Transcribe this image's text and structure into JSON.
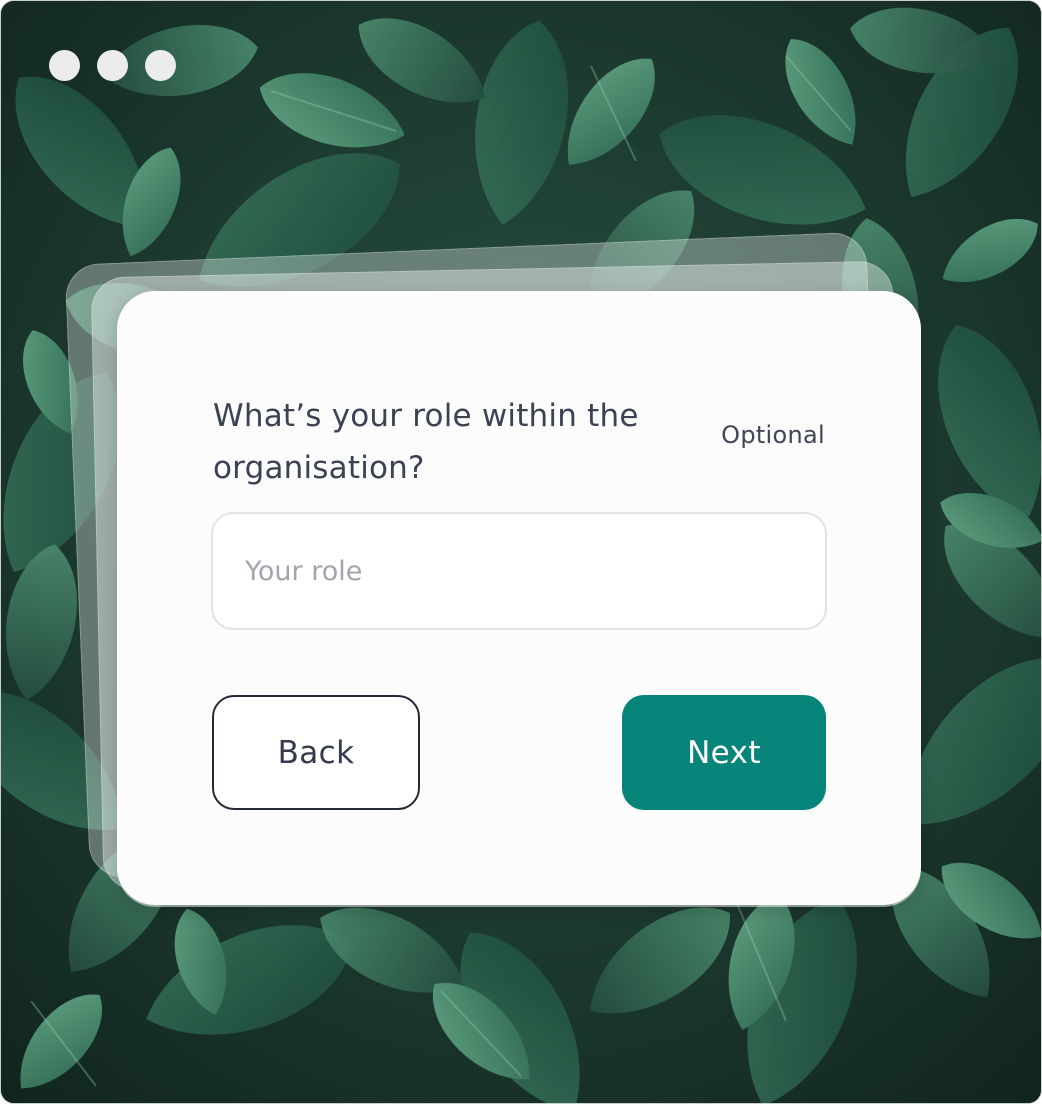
{
  "window": {
    "controls": [
      "dot",
      "dot",
      "dot"
    ]
  },
  "form": {
    "question": "What’s your role within the organisation?",
    "optional_label": "Optional",
    "role_input": {
      "value": "",
      "placeholder": "Your role"
    },
    "back_label": "Back",
    "next_label": "Next"
  },
  "colors": {
    "accent": "#08857a",
    "text": "#3a4254",
    "placeholder": "#a1a5ad",
    "card": "#fcfcfc"
  }
}
